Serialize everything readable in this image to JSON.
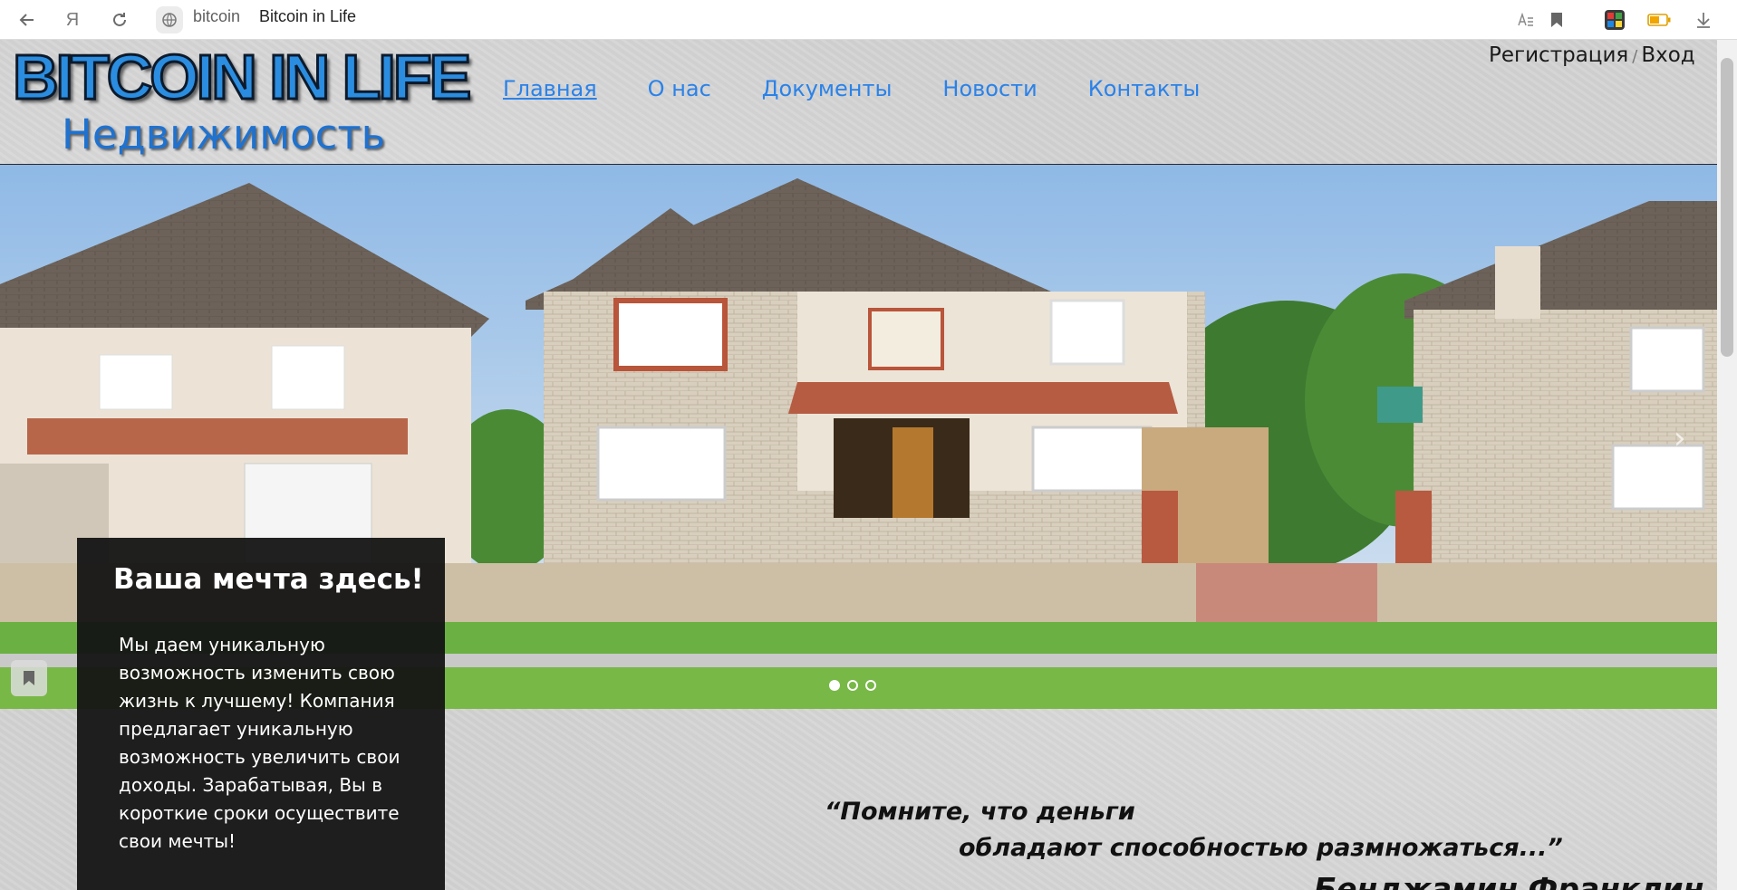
{
  "browser": {
    "domain": "bitcoin",
    "tab_title": "Bitcoin in Life",
    "icons": [
      "back-icon",
      "yandex-icon",
      "reload-icon",
      "site-icon",
      "reader-icon",
      "bookmark-icon",
      "extension-icon",
      "battery-icon",
      "download-icon"
    ]
  },
  "header": {
    "logo_text": "BITCOIN IN LIFE",
    "logo_subtitle": "Недвижимость",
    "nav": [
      {
        "label": "Главная",
        "active": true
      },
      {
        "label": "О нас",
        "active": false
      },
      {
        "label": "Документы",
        "active": false
      },
      {
        "label": "Новости",
        "active": false
      },
      {
        "label": "Контакты",
        "active": false
      }
    ],
    "auth": {
      "register": "Регистрация",
      "separator": "/",
      "login": "Вход"
    }
  },
  "slider": {
    "slide_count": 3,
    "active_index": 0,
    "next_glyph": "›"
  },
  "promo": {
    "title": "Ваша мечта здесь!",
    "text": "Мы даем уникальную возможность изменить свою жизнь к лучшему! Компания предлагает уникальную возможность увеличить свои доходы. Зарабатывая, Вы в короткие сроки осуществите свои мечты!"
  },
  "quote": {
    "line1": "“Помните, что деньги",
    "line2": "обладают способностью размножаться...”",
    "author": "Бенджамин Франклин"
  },
  "colors": {
    "accent": "#2b82e8",
    "logo_blue": "#2b8de0",
    "promo_bg": "#141414",
    "page_bg": "#d3d3d3"
  }
}
